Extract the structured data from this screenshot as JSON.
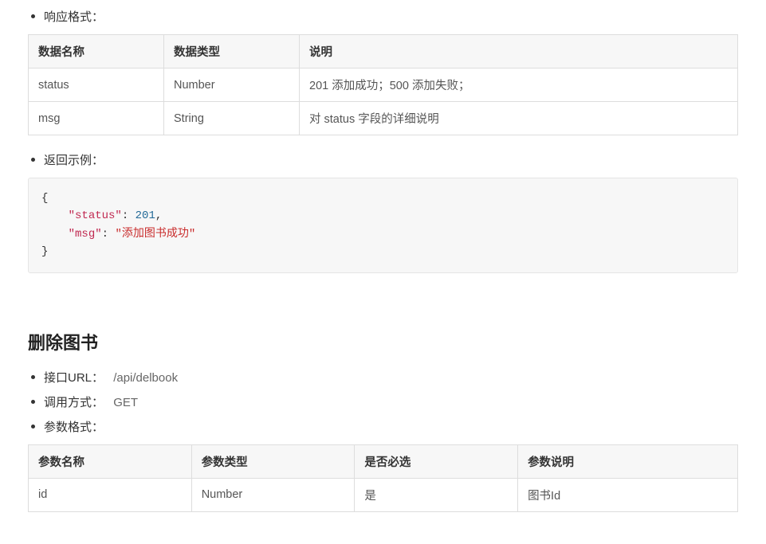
{
  "section1": {
    "response_format_label": "响应格式：",
    "response_table": {
      "headers": [
        "数据名称",
        "数据类型",
        "说明"
      ],
      "rows": [
        {
          "name": "status",
          "type": "Number",
          "desc": "201 添加成功；500 添加失败；"
        },
        {
          "name": "msg",
          "type": "String",
          "desc": "对 status 字段的详细说明"
        }
      ]
    },
    "return_example_label": "返回示例：",
    "code": {
      "open": "{",
      "indent": "    ",
      "k_status": "\"status\"",
      "v_status": "201",
      "comma1": ",",
      "k_msg": "\"msg\"",
      "v_msg": "\"添加图书成功\"",
      "close": "}"
    }
  },
  "section2": {
    "title": "删除图书",
    "url_label": "接口URL：",
    "url_value": "/api/delbook",
    "method_label": "调用方式：",
    "method_value": "GET",
    "param_format_label": "参数格式：",
    "param_table": {
      "headers": [
        "参数名称",
        "参数类型",
        "是否必选",
        "参数说明"
      ],
      "rows": [
        {
          "name": "id",
          "type": "Number",
          "required": "是",
          "desc": "图书Id"
        }
      ]
    }
  }
}
